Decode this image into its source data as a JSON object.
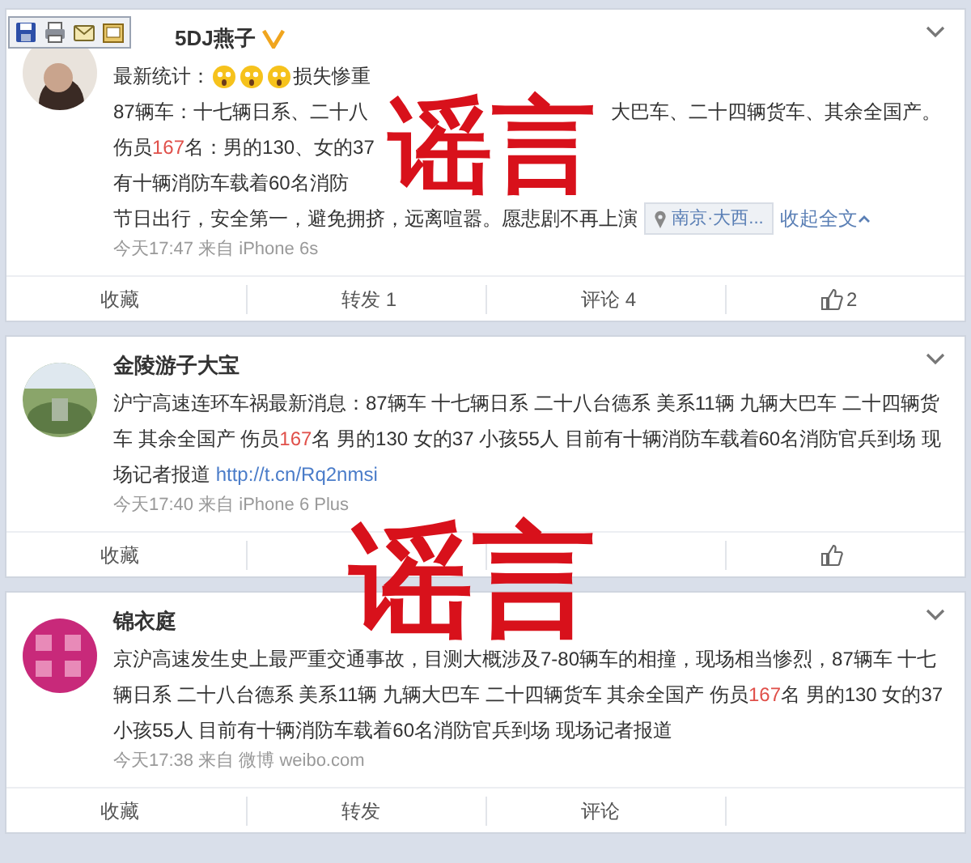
{
  "posts": [
    {
      "author": "5DJ燕子",
      "verified": true,
      "paragraphs": [
        [
          {
            "kind": "text",
            "text": "最新统计："
          },
          {
            "kind": "emoji"
          },
          {
            "kind": "emoji"
          },
          {
            "kind": "emoji"
          },
          {
            "kind": "text",
            "text": "损失惨重"
          }
        ],
        [
          {
            "kind": "text",
            "text": "87辆车：十七辆日系、二十八"
          },
          {
            "kind": "covered"
          },
          {
            "kind": "text",
            "text": "大巴车、二十四辆货车、其余全国产。"
          }
        ],
        [
          {
            "kind": "text",
            "text": "伤员"
          },
          {
            "kind": "number",
            "text": "167"
          },
          {
            "kind": "text",
            "text": "名：男的130、女的37"
          },
          {
            "kind": "covered"
          }
        ],
        [
          {
            "kind": "text",
            "text": "有十辆消防车载着60名消防"
          },
          {
            "kind": "covered"
          }
        ],
        [
          {
            "kind": "text",
            "text": "节日出行，安全第一，避免拥挤，远离喧嚣。愿悲剧不再上演"
          },
          {
            "kind": "location",
            "text": "南京·大西..."
          },
          {
            "kind": "collapse",
            "text": "收起全文"
          }
        ]
      ],
      "meta": "今天17:47 来自 iPhone 6s",
      "actions": [
        {
          "kind": "text",
          "text": "收藏"
        },
        {
          "kind": "text",
          "text": "转发 1"
        },
        {
          "kind": "text",
          "text": "评论 4"
        },
        {
          "kind": "like",
          "text": "2"
        }
      ]
    },
    {
      "author": "金陵游子大宝",
      "verified": false,
      "paragraphs": [
        [
          {
            "kind": "text",
            "text": "沪宁高速连环车祸最新消息：87辆车 十七辆日系 二十八台德系 美系11辆 九辆大巴车 二十四辆货车 其余全国产 伤员"
          },
          {
            "kind": "number",
            "text": "167"
          },
          {
            "kind": "text",
            "text": "名 男的130 女的37 小孩55人 目前有十辆消防车载着60名消防官兵到场 现场记者报道 "
          },
          {
            "kind": "link",
            "text": "http://t.cn/Rq2nmsi"
          }
        ]
      ],
      "meta": "今天17:40 来自 iPhone 6 Plus",
      "actions": [
        {
          "kind": "text",
          "text": "收藏"
        },
        {
          "kind": "covered"
        },
        {
          "kind": "covered"
        },
        {
          "kind": "like"
        }
      ]
    },
    {
      "author": "锦衣庭",
      "verified": false,
      "paragraphs": [
        [
          {
            "kind": "text",
            "text": "京沪高速发生史上最严重交通事故，目测大概涉及7-80辆车的相撞，现场相当惨烈，87辆车 十七辆日系 二十八台德系 美系11辆 九辆大巴车 二十四辆货车 其余全国产 伤员"
          },
          {
            "kind": "number",
            "text": "167"
          },
          {
            "kind": "text",
            "text": "名 男的130 女的37 小孩55人 目前有十辆消防车载着60名消防官兵到场 现场记者报道"
          }
        ]
      ],
      "meta": "今天17:38 来自 微博 weibo.com",
      "actions": [
        {
          "kind": "text",
          "text": "收藏"
        },
        {
          "kind": "text",
          "text": "转发"
        },
        {
          "kind": "text",
          "text": "评论"
        }
      ]
    }
  ],
  "stamps": [
    "谣言",
    "谣言"
  ]
}
